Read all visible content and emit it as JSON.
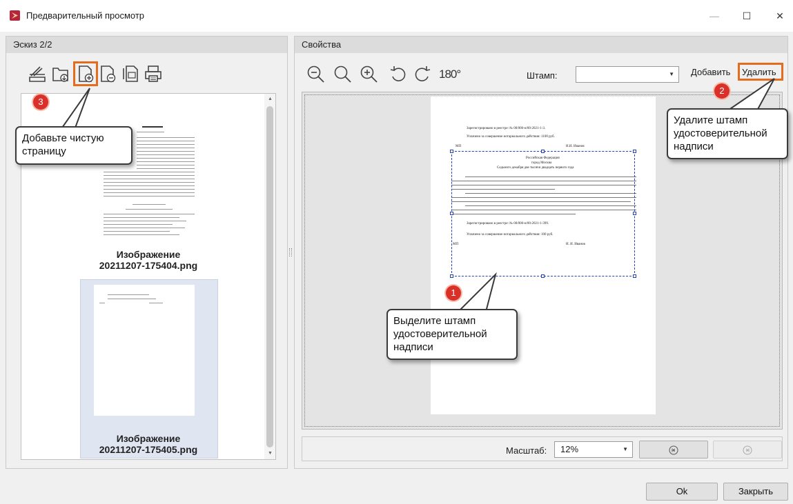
{
  "window": {
    "title": "Предварительный просмотр",
    "minimize": "—",
    "maximize": "☐",
    "close": "✕"
  },
  "left_panel": {
    "title": "Эскиз 2/2",
    "toolbar_icons": [
      "scanner-icon",
      "import-folder-icon",
      "add-page-icon",
      "remove-page-icon",
      "copy-page-icon",
      "print-icon"
    ],
    "thumbnails": [
      {
        "label_line1": "Изображение",
        "label_line2": "20211207-175404.png",
        "selected": false
      },
      {
        "label_line1": "Изображение",
        "label_line2": "20211207-175405.png",
        "selected": true
      }
    ]
  },
  "right_panel": {
    "title": "Свойства",
    "stamp_label": "Штамп:",
    "stamp_value": "",
    "add_label": "Добавить",
    "delete_label": "Удалить",
    "rotate_180_label": "180°",
    "scale_label": "Масштаб:",
    "scale_value": "12%"
  },
  "document": {
    "lines": [
      "Зарегистрировано в реестре: № 00/000-н/00-2021-1-3.",
      "Уплачено за совершение нотариального действия: 1100 руб.",
      "МП",
      "И.И. Иванов"
    ],
    "stamp_lines": [
      "Российская Федерация",
      "город Москва",
      "Седьмого декабря две тысячи двадцать первого года",
      "Зарегистрировано в реестре: № 00/000-н/00-2021-1-399.",
      "Уплачено за совершение нотариального действия: 100 руб.",
      "МП",
      "И. И. Иванов"
    ]
  },
  "callouts": {
    "c1": {
      "number": "1",
      "text": "Выделите штамп удостоверительной надписи"
    },
    "c2": {
      "number": "2",
      "text": "Удалите штамп удостоверительной надписи"
    },
    "c3": {
      "number": "3",
      "text": "Добавьте чистую страницу"
    }
  },
  "footer": {
    "ok_label": "Ok",
    "close_label": "Закрыть"
  },
  "colors": {
    "highlight": "#e56b1f",
    "badge": "#d9302a",
    "stamp_border": "#1f3fbf"
  }
}
